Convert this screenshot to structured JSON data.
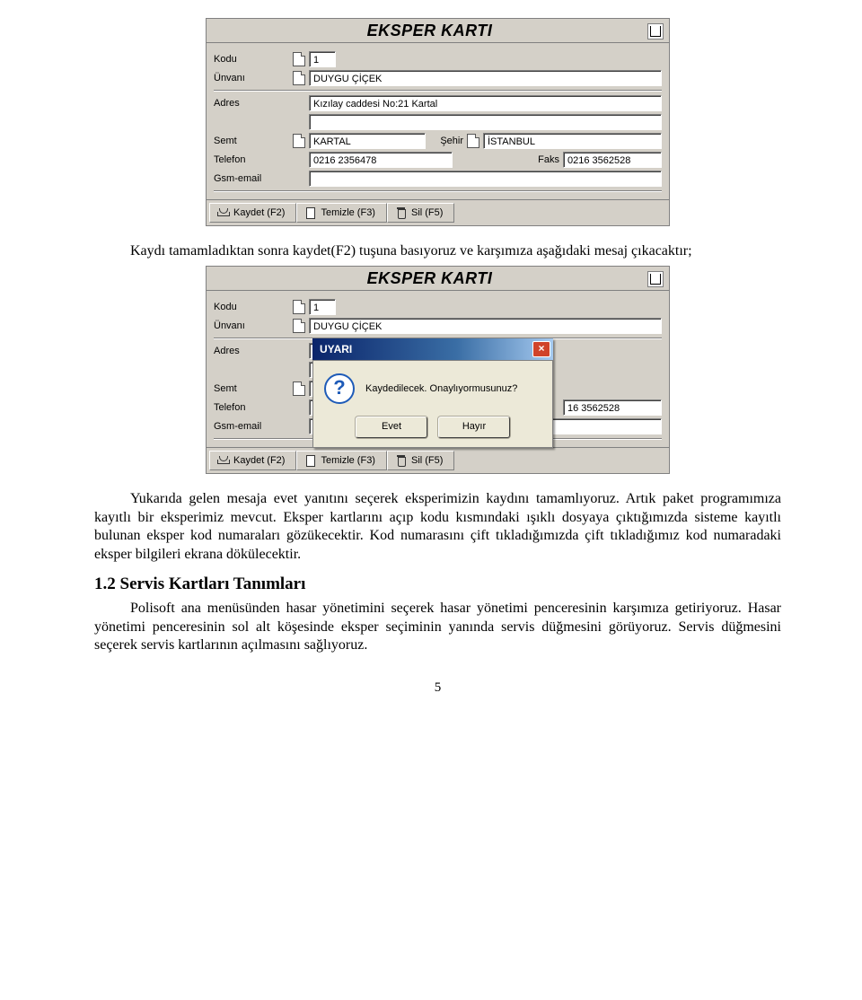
{
  "form1": {
    "title": "EKSPER KARTI",
    "fields": {
      "kodu_label": "Kodu",
      "kodu_value": "1",
      "unvani_label": "Ünvanı",
      "unvani_value": "DUYGU ÇİÇEK",
      "adres_label": "Adres",
      "adres_value": "Kızılay caddesi No:21 Kartal",
      "semt_label": "Semt",
      "semt_value": "KARTAL",
      "sehir_label": "Şehir",
      "sehir_value": "İSTANBUL",
      "telefon_label": "Telefon",
      "telefon_value": "0216 2356478",
      "faks_label": "Faks",
      "faks_value": "0216 3562528",
      "gsm_label": "Gsm-email",
      "gsm_value": ""
    },
    "buttons": {
      "kaydet": "Kaydet (F2)",
      "temizle": "Temizle (F3)",
      "sil": "Sil (F5)"
    }
  },
  "paragraph1": "Kaydı tamamladıktan sonra kaydet(F2) tuşuna basıyoruz ve karşımıza aşağıdaki mesaj çıkacaktır;",
  "form2": {
    "title": "EKSPER KARTI",
    "fields": {
      "kodu_label": "Kodu",
      "kodu_value": "1",
      "unvani_label": "Ünvanı",
      "unvani_value": "DUYGU ÇİÇEK",
      "adres_label": "Adres",
      "semt_label": "Semt",
      "telefon_label": "Telefon",
      "faks_value": "16 3562528",
      "gsm_label": "Gsm-email"
    },
    "dialog": {
      "title": "UYARI",
      "message": "Kaydedilecek. Onaylıyormusunuz?",
      "yes": "Evet",
      "no": "Hayır"
    },
    "buttons": {
      "kaydet": "Kaydet (F2)",
      "temizle": "Temizle (F3)",
      "sil": "Sil (F5)"
    }
  },
  "paragraph2": "Yukarıda gelen mesaja evet yanıtını seçerek eksperimizin kaydını tamamlıyoruz. Artık paket programımıza kayıtlı bir eksperimiz mevcut. Eksper kartlarını açıp kodu kısmındaki ışıklı dosyaya çıktığımızda sisteme kayıtlı bulunan eksper kod numaraları gözükecektir. Kod numarasını çift tıkladığımızda çift tıkladığımız kod numaradaki eksper bilgileri ekrana dökülecektir.",
  "heading": "1.2 Servis Kartları Tanımları",
  "paragraph3": "Polisoft ana menüsünden hasar yönetimini seçerek hasar yönetimi penceresinin karşımıza getiriyoruz. Hasar yönetimi penceresinin sol alt köşesinde eksper seçiminin yanında servis düğmesini görüyoruz. Servis düğmesini seçerek servis kartlarının açılmasını sağlıyoruz.",
  "page_number": "5"
}
